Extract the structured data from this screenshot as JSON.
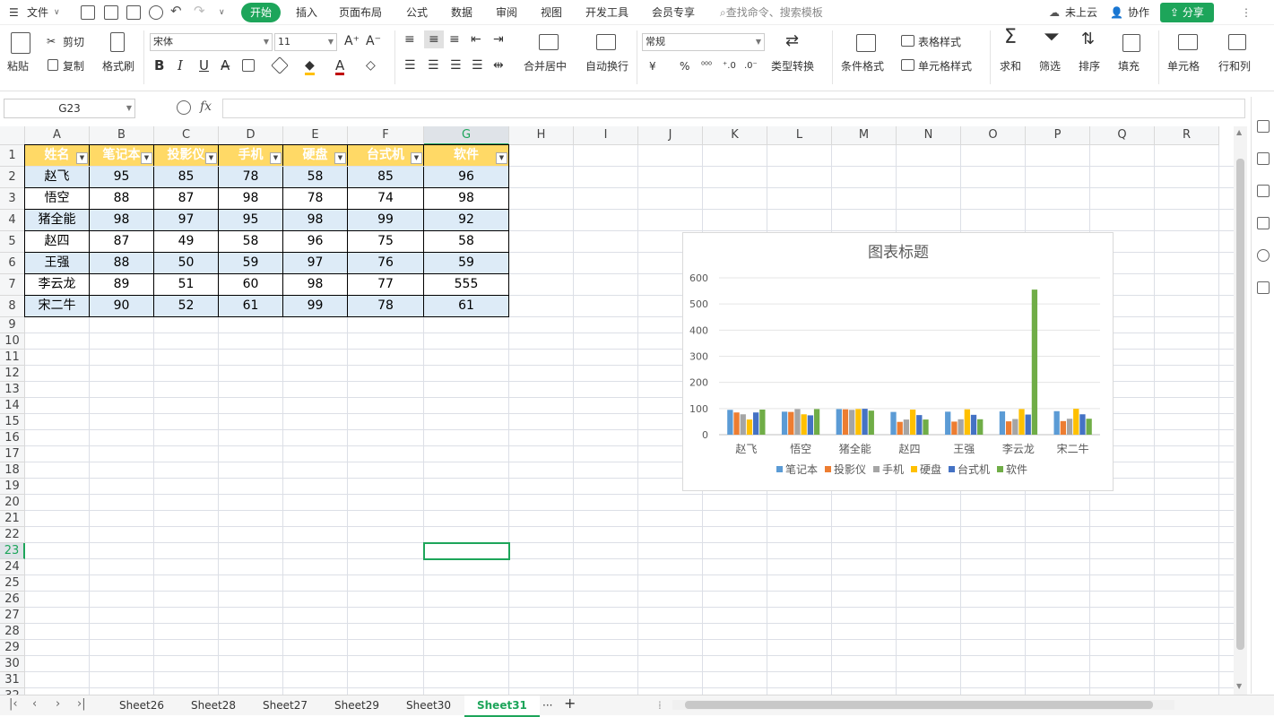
{
  "menubar": {
    "file": "文件",
    "start": "开始",
    "tabs": [
      "插入",
      "页面布局",
      "公式",
      "数据",
      "审阅",
      "视图",
      "开发工具",
      "会员专享"
    ],
    "search_placeholder": "查找命令、搜索模板",
    "cloud": "未上云",
    "collab": "协作",
    "share": "分享"
  },
  "ribbon": {
    "paste": "粘贴",
    "cut": "剪切",
    "copy": "复制",
    "format_painter": "格式刷",
    "font": "宋体",
    "font_size": "11",
    "bold": "B",
    "italic": "I",
    "underline": "U",
    "merge": "合并居中",
    "wrap": "自动换行",
    "number_format": "常规",
    "currency": "¥",
    "percent": "%",
    "type_convert": "类型转换",
    "cond_format": "条件格式",
    "table_style": "表格样式",
    "cell_style": "单元格样式",
    "sum": "求和",
    "filter": "筛选",
    "sort": "排序",
    "fill": "填充",
    "cell": "单元格",
    "rowcol": "行和列"
  },
  "formulabar": {
    "name_box": "G23",
    "fx": "fx",
    "formula": ""
  },
  "grid": {
    "columns": [
      "A",
      "B",
      "C",
      "D",
      "E",
      "F",
      "G",
      "H",
      "I",
      "J",
      "K",
      "L",
      "M",
      "N",
      "O",
      "P",
      "Q",
      "R"
    ],
    "col_widths": [
      72,
      72,
      72,
      72,
      72,
      85,
      95,
      72,
      72,
      72,
      72,
      72,
      72,
      72,
      72,
      72,
      72,
      72
    ],
    "rows": [
      "1",
      "2",
      "3",
      "4",
      "5",
      "6",
      "7",
      "8",
      "9",
      "10",
      "11",
      "12",
      "13",
      "14",
      "15",
      "16",
      "17",
      "18",
      "19",
      "20",
      "21",
      "22",
      "23",
      "24",
      "25",
      "26",
      "27",
      "28",
      "29",
      "30",
      "31",
      "32"
    ],
    "selected_col": "G",
    "selected_row": "23"
  },
  "table": {
    "headers": [
      "姓名",
      "笔记本",
      "投影仪",
      "手机",
      "硬盘",
      "台式机",
      "软件"
    ],
    "header_color": "#ffd966",
    "band_color": "#ddebf7",
    "rows": [
      [
        "赵飞",
        "95",
        "85",
        "78",
        "58",
        "85",
        "96"
      ],
      [
        "悟空",
        "88",
        "87",
        "98",
        "78",
        "74",
        "98"
      ],
      [
        "猪全能",
        "98",
        "97",
        "95",
        "98",
        "99",
        "92"
      ],
      [
        "赵四",
        "87",
        "49",
        "58",
        "96",
        "75",
        "58"
      ],
      [
        "王强",
        "88",
        "50",
        "59",
        "97",
        "76",
        "59"
      ],
      [
        "李云龙",
        "89",
        "51",
        "60",
        "98",
        "77",
        "555"
      ],
      [
        "宋二牛",
        "90",
        "52",
        "61",
        "99",
        "78",
        "61"
      ]
    ]
  },
  "chart_data": {
    "type": "bar",
    "title": "图表标题",
    "categories": [
      "赵飞",
      "悟空",
      "猪全能",
      "赵四",
      "王强",
      "李云龙",
      "宋二牛"
    ],
    "series": [
      {
        "name": "笔记本",
        "color": "#5b9bd5",
        "values": [
          95,
          88,
          98,
          87,
          88,
          89,
          90
        ]
      },
      {
        "name": "投影仪",
        "color": "#ed7d31",
        "values": [
          85,
          87,
          97,
          49,
          50,
          51,
          52
        ]
      },
      {
        "name": "手机",
        "color": "#a5a5a5",
        "values": [
          78,
          98,
          95,
          58,
          59,
          60,
          61
        ]
      },
      {
        "name": "硬盘",
        "color": "#ffc000",
        "values": [
          58,
          78,
          98,
          96,
          97,
          98,
          99
        ]
      },
      {
        "name": "台式机",
        "color": "#4472c4",
        "values": [
          85,
          74,
          99,
          75,
          76,
          77,
          78
        ]
      },
      {
        "name": "软件",
        "color": "#70ad47",
        "values": [
          96,
          98,
          92,
          58,
          59,
          555,
          61
        ]
      }
    ],
    "yticks": [
      "0",
      "100",
      "200",
      "300",
      "400",
      "500",
      "600"
    ],
    "ylim": [
      0,
      600
    ],
    "legend": "bottom",
    "grid": true
  },
  "sheets": {
    "tabs": [
      "Sheet26",
      "Sheet28",
      "Sheet27",
      "Sheet29",
      "Sheet30",
      "Sheet31"
    ],
    "active": "Sheet31",
    "more": "···",
    "add": "+"
  },
  "accent": "#1da55a"
}
